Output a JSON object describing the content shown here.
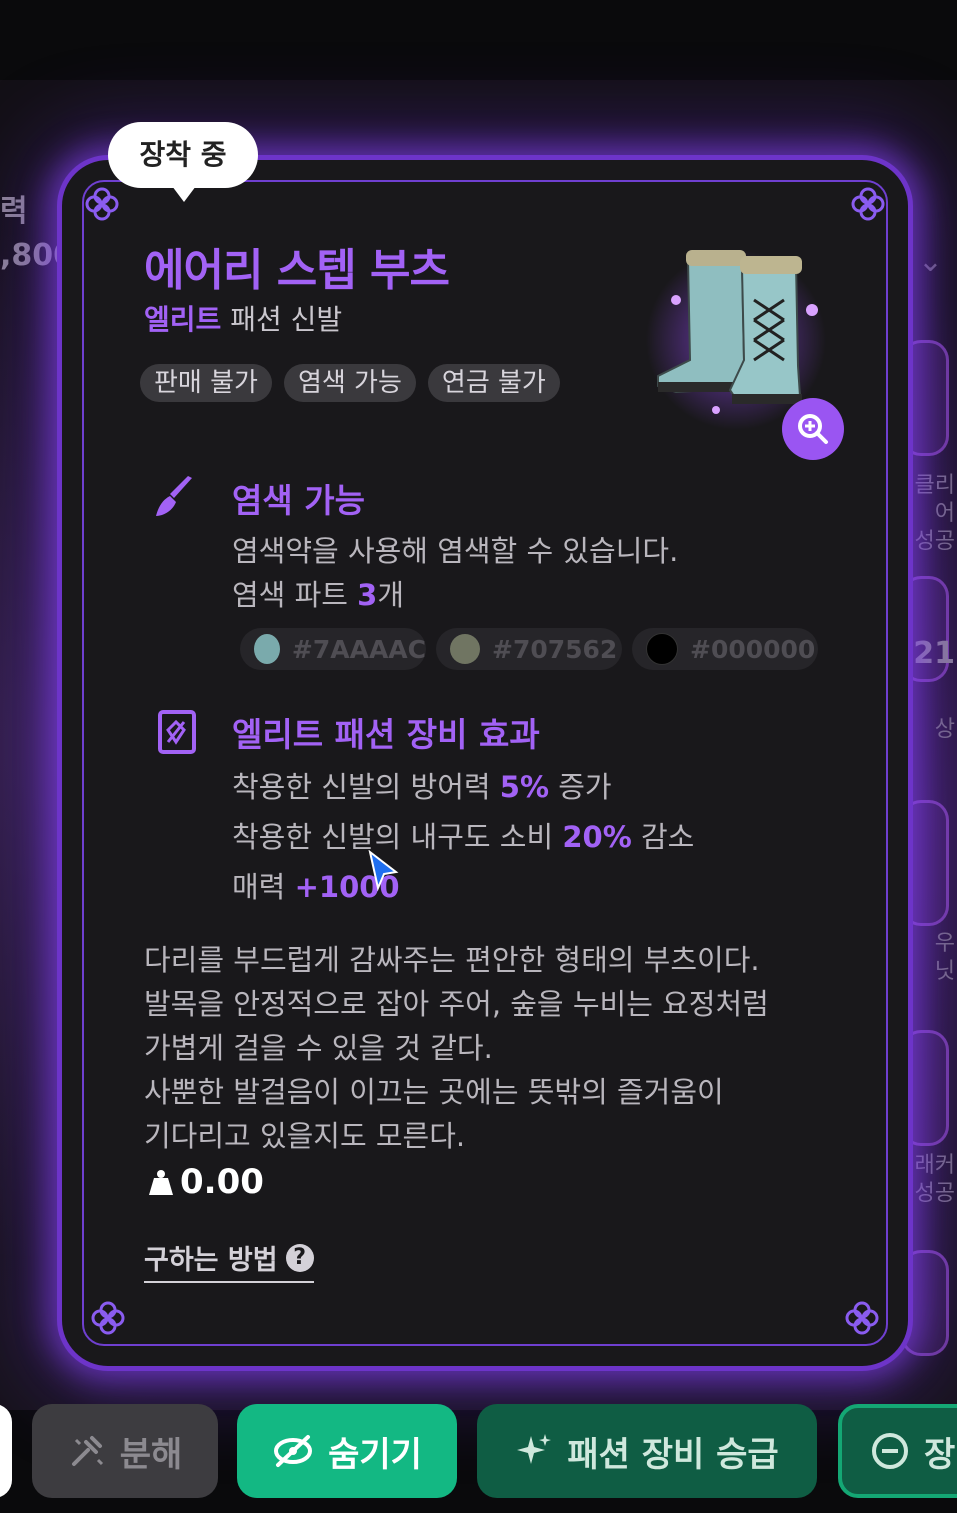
{
  "background": {
    "left_fragment_top": "력",
    "left_fragment_bottom": ",800",
    "right_fragments": [
      "클리어",
      "성공",
      "21",
      "상",
      "우",
      "닛",
      "래커",
      "성공"
    ]
  },
  "badge": {
    "label": "장착 중"
  },
  "item": {
    "name": "에어리 스텝 부츠",
    "grade": "엘리트",
    "category": "패션 신발",
    "tags": [
      "판매 불가",
      "염색 가능",
      "연금 불가"
    ],
    "image_icon": "boots-image",
    "zoom_icon": "zoom-in-icon"
  },
  "dye_section": {
    "icon": "brush-icon",
    "title": "염색 가능",
    "description": "염색약을 사용해 염색할 수 있습니다.",
    "parts_prefix": "염색 파트 ",
    "parts_count": "3",
    "parts_suffix": "개",
    "colors": [
      {
        "hex": "#7AAAAC",
        "swatch": "#7AAAAC"
      },
      {
        "hex": "#707562",
        "swatch": "#707562"
      },
      {
        "hex": "#000000",
        "swatch": "#000000"
      }
    ]
  },
  "effect_section": {
    "icon": "fashion-effect-icon",
    "title": "엘리트 패션 장비 효과",
    "lines": [
      {
        "prefix": "착용한 신발의 방어력 ",
        "value": "5%",
        "suffix": " 증가"
      },
      {
        "prefix": "착용한 신발의 내구도 소비 ",
        "value": "20%",
        "suffix": " 감소"
      },
      {
        "prefix": "매력 ",
        "value": "+1000",
        "suffix": ""
      }
    ]
  },
  "description_lines": [
    "다리를 부드럽게 감싸주는 편안한 형태의 부츠이다.",
    "발목을 안정적으로 잡아 주어, 숲을 누비는 요정처럼",
    "가볍게 걸을 수 있을 것 같다.",
    "사뿐한 발걸음이 이끄는 곳에는 뜻밖의 즐거움이",
    "기다리고 있을지도 모른다."
  ],
  "weight": {
    "icon": "weight-icon",
    "value": "0.00"
  },
  "how_to_obtain": {
    "label": "구하는 방법",
    "icon": "question-icon"
  },
  "buttons": {
    "disassemble": "분해",
    "hide": "숨기기",
    "upgrade": "패션 장비 승급",
    "unequip": "장"
  },
  "colors": {
    "accent_purple": "#A262F5",
    "glow_purple": "#6D34C9",
    "hide_green": "#13B883",
    "upgrade_green": "#0F5D44"
  }
}
